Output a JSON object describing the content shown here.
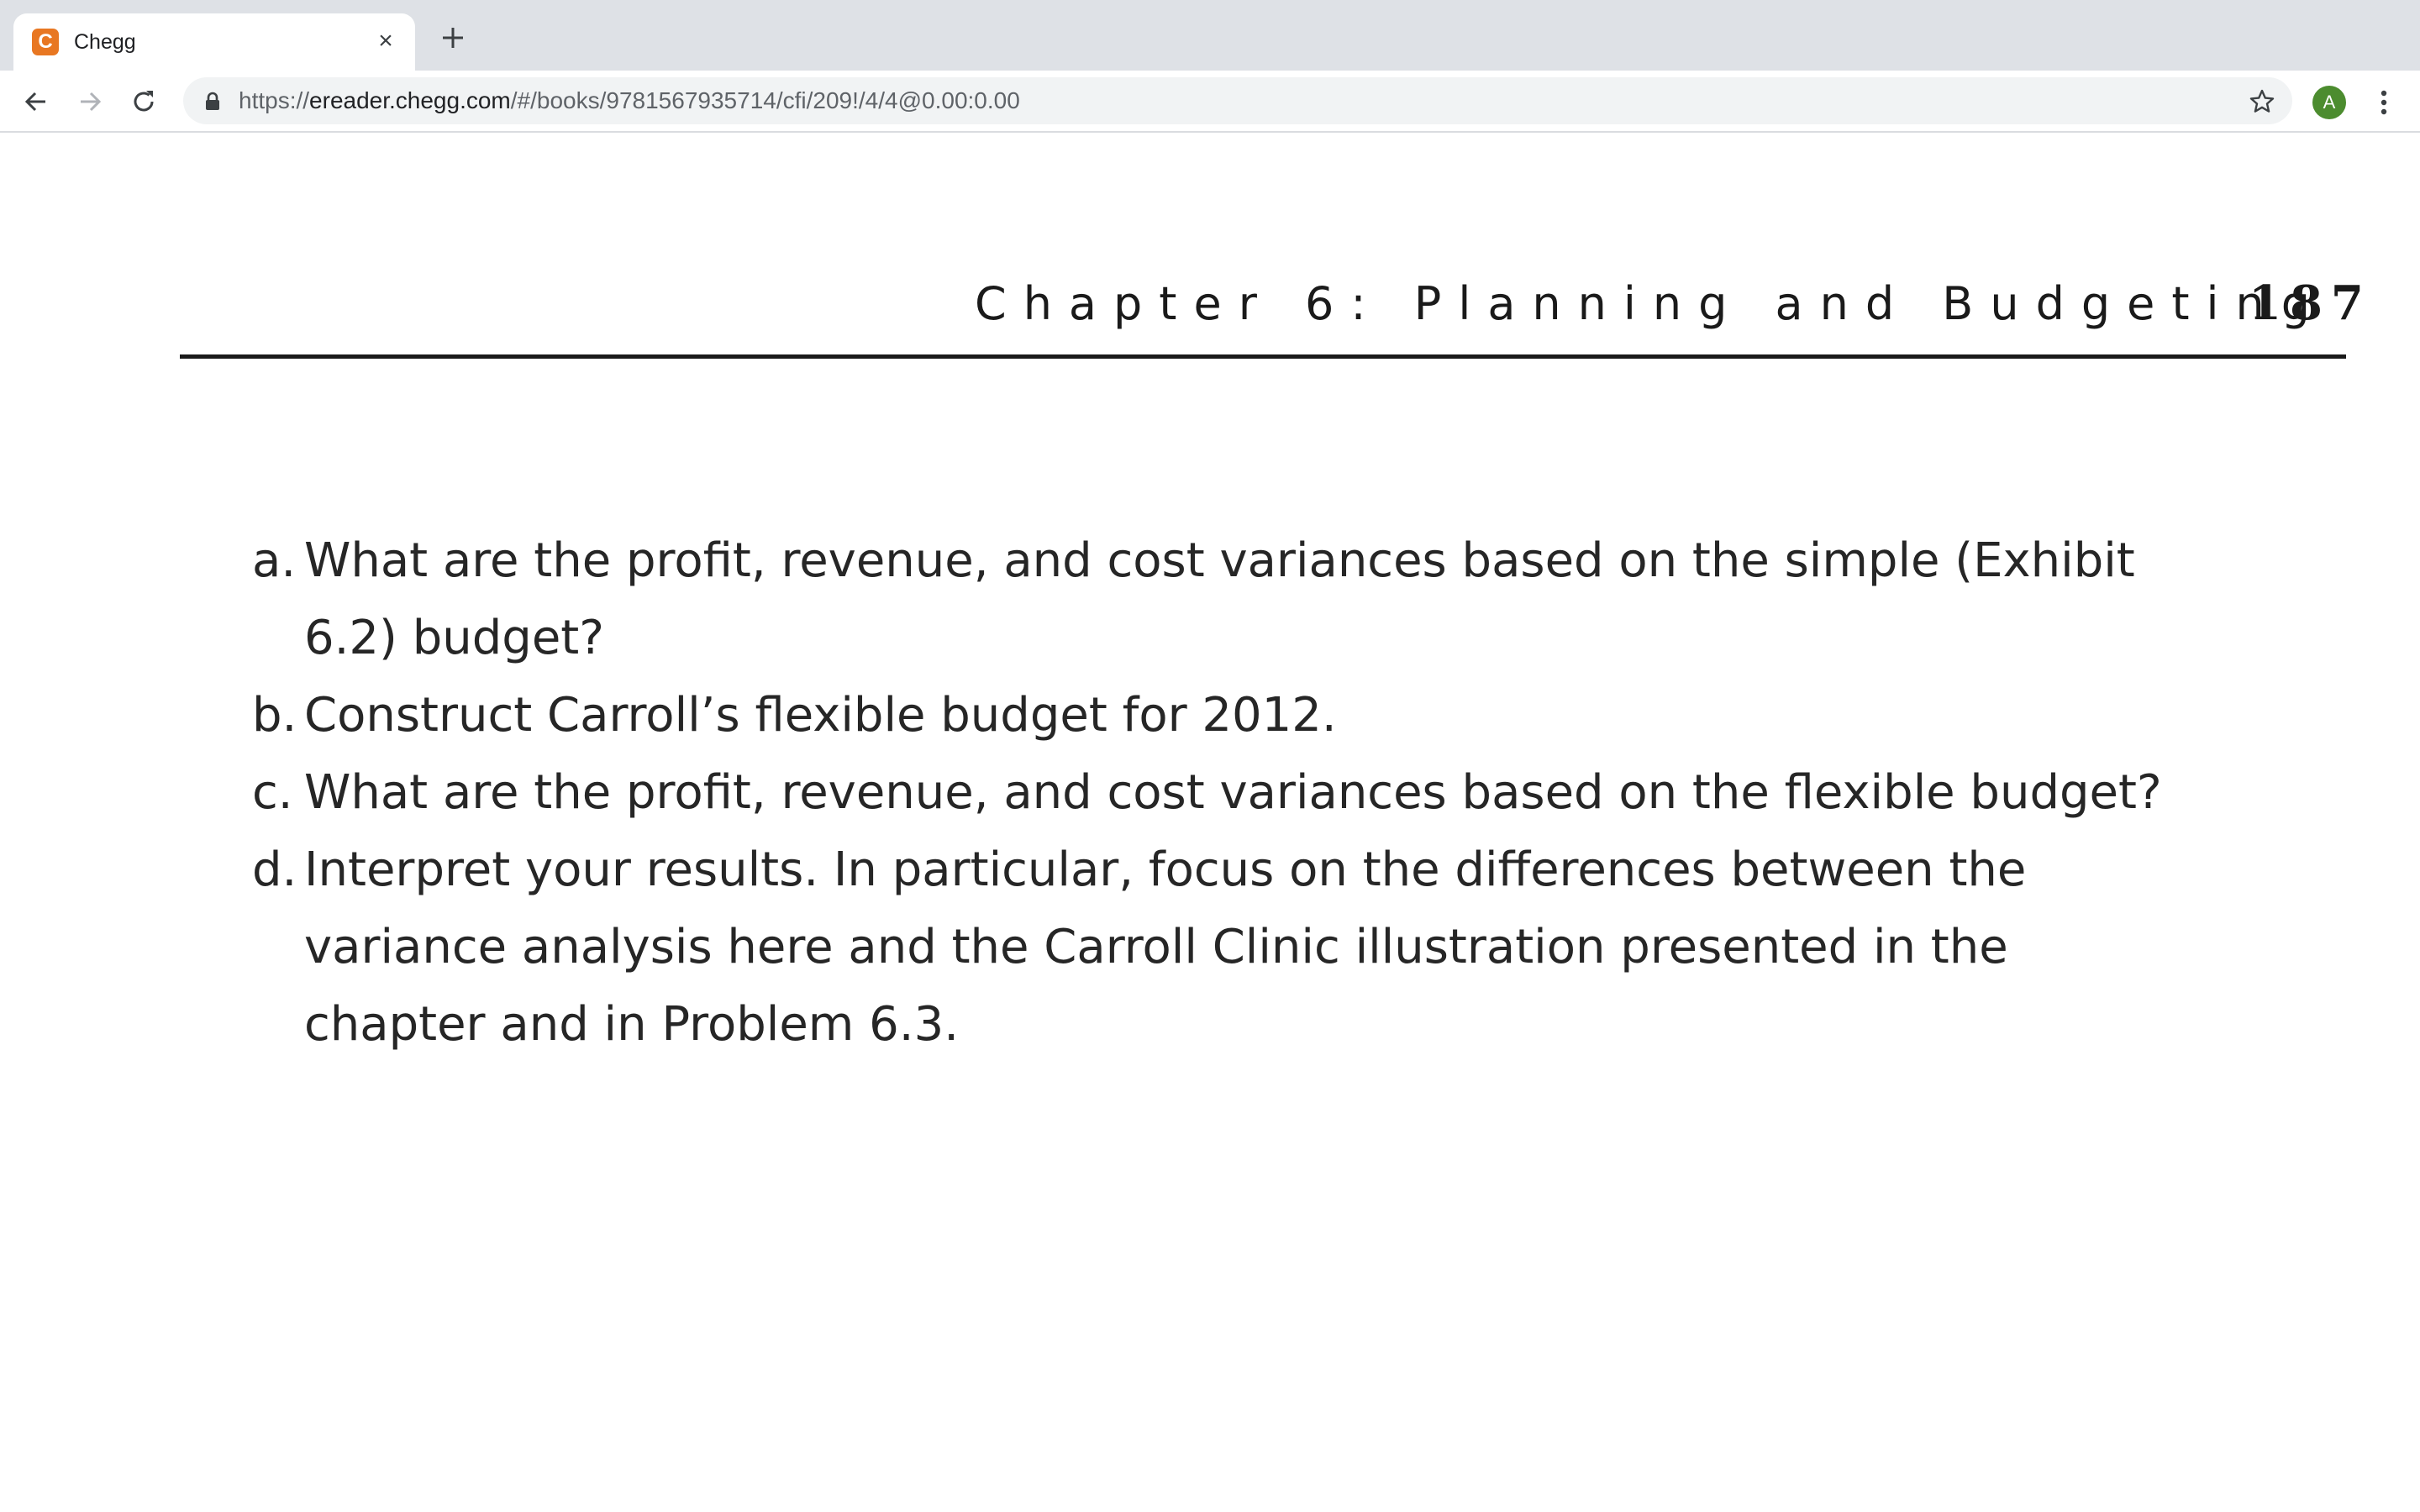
{
  "browser": {
    "tab": {
      "favicon_letter": "C",
      "title": "Chegg",
      "close_glyph": "×"
    },
    "address_bar": {
      "url_prefix": "https://",
      "url_host": "ereader.chegg.com",
      "url_path": "/#/books/9781567935714/cfi/209!/4/4@0.00:0.00"
    },
    "profile": {
      "initial": "A",
      "color": "#4c8c2f"
    },
    "icons": [
      "back-arrow-icon",
      "forward-arrow-icon",
      "reload-icon",
      "lock-icon",
      "star-icon",
      "kebab-menu-icon",
      "plus-icon",
      "close-icon"
    ]
  },
  "page": {
    "running_head": "Chapter 6: Planning and Budgeting",
    "page_number": "187",
    "questions": [
      {
        "label": "a.",
        "lines": [
          "What are the profit, revenue, and cost variances based on the simple (Exhibit",
          "6.2) budget?"
        ]
      },
      {
        "label": "b.",
        "lines": [
          "Construct Carroll’s flexible budget for 2012."
        ]
      },
      {
        "label": "c.",
        "lines": [
          "What are the profit, revenue, and cost variances based on the flexible budget?"
        ]
      },
      {
        "label": "d.",
        "lines": [
          "Interpret your results. In particular, focus on the differences between the",
          "variance analysis here and the Carroll Clinic illustration presented in the",
          "chapter and in Problem 6.3."
        ]
      }
    ]
  }
}
